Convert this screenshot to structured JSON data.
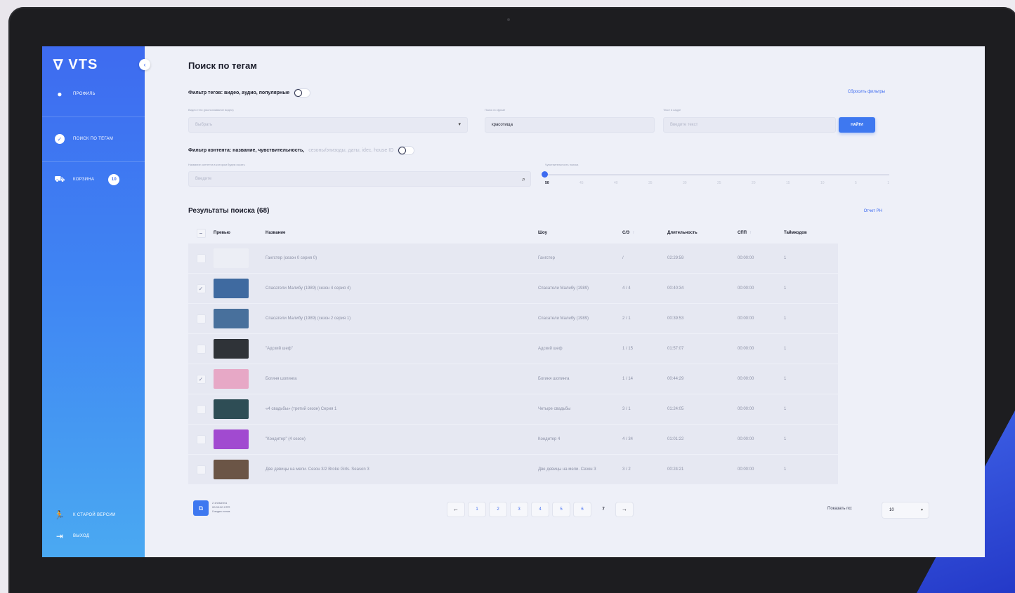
{
  "sidebar": {
    "logo": "VTS",
    "items": [
      {
        "label": "Профиль",
        "icon": "user-icon"
      },
      {
        "label": "Поиск по тегам",
        "icon": "tag-icon"
      },
      {
        "label": "Корзина",
        "icon": "cart-icon",
        "badge": "10"
      },
      {
        "label": "К старой версии",
        "icon": "runner-icon"
      },
      {
        "label": "Выход",
        "icon": "logout-icon"
      }
    ]
  },
  "page": {
    "title": "Поиск по тегам"
  },
  "tag_filter": {
    "label": "Фильтр тегов: видео, аудио, популярные",
    "reset_label": "Сбросить фильтры",
    "video_type_caption": "Видео теги (распознавание видео)",
    "video_type_placeholder": "Выбрать",
    "phrase_caption": "Поиск по фразе",
    "phrase_value": "красотища",
    "frame_text_caption": "Текст в кадре",
    "frame_text_placeholder": "Введите текст",
    "find_button": "НАЙТИ"
  },
  "content_filter": {
    "label": "Фильтр контента: название, чувствительность,",
    "label_muted": "сезоны/эпизоды, даты, idec, house ID",
    "name_caption": "Название контента в котором будем искать",
    "name_placeholder": "Введите",
    "sensitivity_caption": "Чувствительность поиска",
    "sensitivity_ticks": [
      "50",
      "45",
      "40",
      "35",
      "30",
      "25",
      "20",
      "15",
      "10",
      "5",
      "1"
    ],
    "sensitivity_value": 50
  },
  "results": {
    "title": "Результаты поиска (68)",
    "report_link": "Отчет PH",
    "columns": {
      "preview": "Превью",
      "name": "Название",
      "show": "Шоу",
      "season_episode": "С/Э",
      "duration": "Длительность",
      "spp": "СПП",
      "timecodes": "Таймкодов"
    },
    "rows": [
      {
        "checked": false,
        "name": "Гангстер (сезон 0 серия 0)",
        "show": "Гангстер",
        "se": "/",
        "duration": "02:29:59",
        "spp": "00:00:00",
        "timecodes": "1",
        "thumb": "#eceef5"
      },
      {
        "checked": true,
        "name": "Спасатели Малибу (1989) (сезон 4 серия 4)",
        "show": "Спасатели Малибу (1989)",
        "se": "4 / 4",
        "duration": "00:40:34",
        "spp": "00:00:00",
        "timecodes": "1",
        "thumb": "#3f6aa0"
      },
      {
        "checked": false,
        "name": "Спасатели Малибу (1989) (сезон 2 серия 1)",
        "show": "Спасатели Малибу (1989)",
        "se": "2 / 1",
        "duration": "00:39:53",
        "spp": "00:00:00",
        "timecodes": "1",
        "thumb": "#48709c"
      },
      {
        "checked": false,
        "name": "\"Адский шеф\"",
        "show": "Адский шеф",
        "se": "1 / 15",
        "duration": "01:57:07",
        "spp": "00:00:00",
        "timecodes": "1",
        "thumb": "#2f3338"
      },
      {
        "checked": true,
        "name": "Богиня шопинга",
        "show": "Богиня шопинга",
        "se": "1 / 14",
        "duration": "00:44:29",
        "spp": "00:00:00",
        "timecodes": "1",
        "thumb": "#e7a8c6"
      },
      {
        "checked": false,
        "name": "«4 свадьбы» (третий сезон) Серия 1",
        "show": "Четыре свадьбы",
        "se": "3 / 1",
        "duration": "01:24:05",
        "spp": "00:00:00",
        "timecodes": "1",
        "thumb": "#2e4d55"
      },
      {
        "checked": false,
        "name": "\"Кондитер\" (4 сезон)",
        "show": "Кондитер 4",
        "se": "4 / 34",
        "duration": "01:01:22",
        "spp": "00:00:00",
        "timecodes": "1",
        "thumb": "#a14ad0"
      },
      {
        "checked": false,
        "name": "Две девицы на мели. Сезон 3/2 Broke Girls. Season 3",
        "show": "Две девицы на мели. Сезон 3",
        "se": "3 / 2",
        "duration": "00:24:21",
        "spp": "00:00:00",
        "timecodes": "1",
        "thumb": "#6b5546"
      }
    ]
  },
  "footer": {
    "legend": [
      "2 элемента",
      "00:00:00 СПП",
      "0 видео тегов"
    ],
    "pages": [
      "1",
      "2",
      "3",
      "4",
      "5",
      "6",
      "7"
    ],
    "current_page": "7",
    "show_label": "Показать по:",
    "show_value": "10"
  }
}
